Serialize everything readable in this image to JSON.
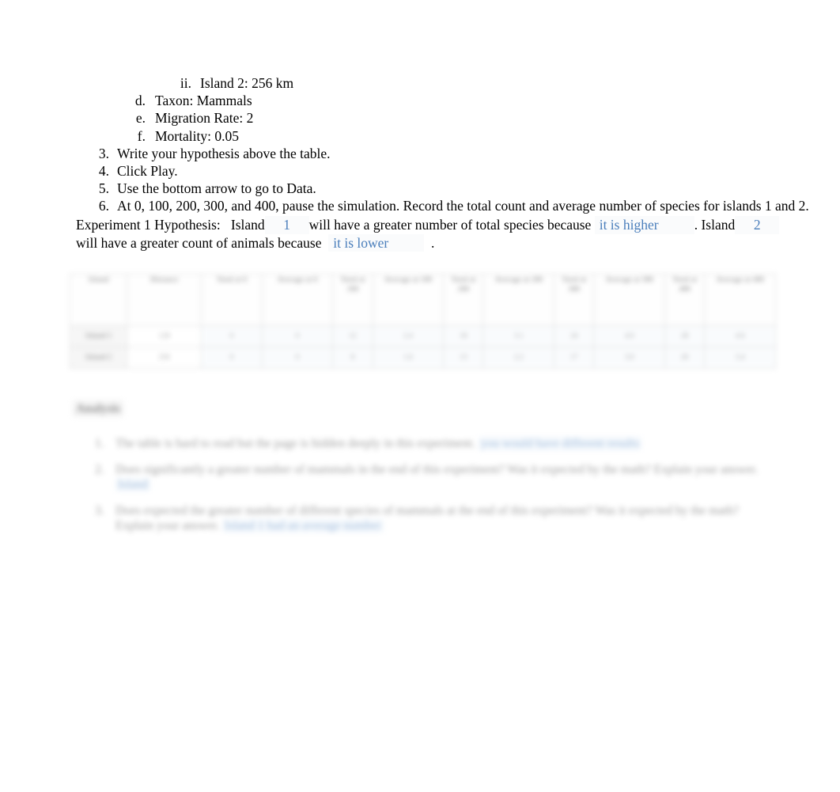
{
  "document": {
    "instructions": [
      {
        "level": "roman",
        "marker": "ii.",
        "text": "Island 2: 256 km"
      },
      {
        "level": "alpha",
        "marker": "d.",
        "text": "Taxon: Mammals"
      },
      {
        "level": "alpha",
        "marker": "e.",
        "text": "Migration Rate: 2"
      },
      {
        "level": "alpha",
        "marker": "f.",
        "text": "Mortality: 0.05"
      },
      {
        "level": "num",
        "marker": "3.",
        "text": "Write your hypothesis above the table."
      },
      {
        "level": "num",
        "marker": "4.",
        "text": "Click Play."
      },
      {
        "level": "num",
        "marker": "5.",
        "text": "Use the bottom arrow to go to Data."
      },
      {
        "level": "num",
        "marker": "6.",
        "text": "At 0, 100, 200, 300, and 400, pause the simulation. Record the total count and average number of species for islands 1 and 2."
      }
    ],
    "hypothesis": {
      "label": "Experiment 1 Hypothesis:",
      "seg_island_1": "Island",
      "answer_island_1": "1",
      "seg_mid_1": "will have a greater number of total species because",
      "answer_reason_1": "it is higher",
      "seg_period_1": ". Island",
      "answer_island_2": "2",
      "seg_mid_2": "will have a greater count of animals because",
      "answer_reason_2": "it is lower",
      "seg_period_2": "."
    },
    "table": {
      "headers": [
        "Island",
        "Distance",
        "Total at 0",
        "Average at 0",
        "Total at 100",
        "Average at 100",
        "Total at 200",
        "Average at 200",
        "Total at 300",
        "Average at 300",
        "Total at 400",
        "Average at 400"
      ],
      "rows": [
        {
          "label": "Island 1",
          "cells": [
            "128",
            "0",
            "0",
            "12",
            "2.4",
            "18",
            "3.1",
            "24",
            "4.0",
            "28",
            "4.6"
          ]
        },
        {
          "label": "Island 2",
          "cells": [
            "256",
            "0",
            "0",
            "8",
            "1.6",
            "13",
            "2.2",
            "17",
            "3.0",
            "20",
            "3.4"
          ]
        }
      ]
    },
    "questions": {
      "heading": "Analysis",
      "items": [
        {
          "number": "1.",
          "text": "The table is hard to read but the page is hidden deeply in this experiment.",
          "answer": "you would have different results",
          "blank_class": "bl-1"
        },
        {
          "number": "2.",
          "text": "Does significantly a greater number of mammals in the end of this experiment? Was it expected by the math? Explain your answer.",
          "answer": "Island",
          "blank_class": "bl-2"
        },
        {
          "number": "3.",
          "text": "Does expected the greater number of different species of mammals at the end of this experiment? Was it expected by the math? Explain your answer.",
          "answer": "Island 1 had an average number",
          "blank_class": "bl-3"
        }
      ]
    }
  }
}
